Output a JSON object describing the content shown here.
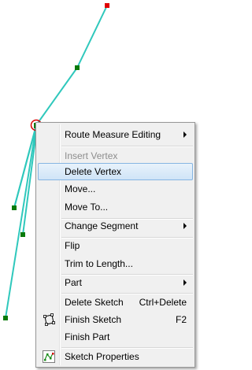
{
  "colors": {
    "segment": "#2fc8bc",
    "vertex": "#0a7a0a",
    "last_vertex": "#e00000",
    "selection_circle": "#d40000"
  },
  "menu": {
    "items": [
      {
        "label": "Route Measure Editing",
        "submenu": true
      },
      {
        "label": "Insert Vertex",
        "disabled": true
      },
      {
        "label": "Delete Vertex",
        "highlighted": true
      },
      {
        "label": "Move..."
      },
      {
        "label": "Move To..."
      },
      {
        "label": "Change Segment",
        "submenu": true
      },
      {
        "label": "Flip"
      },
      {
        "label": "Trim to Length..."
      },
      {
        "label": "Part",
        "submenu": true
      },
      {
        "label": "Delete Sketch",
        "shortcut": "Ctrl+Delete"
      },
      {
        "label": "Finish Sketch",
        "shortcut": "F2",
        "icon": "finish-sketch-icon"
      },
      {
        "label": "Finish Part"
      },
      {
        "label": "Sketch Properties",
        "icon": "sketch-properties-icon"
      }
    ]
  }
}
